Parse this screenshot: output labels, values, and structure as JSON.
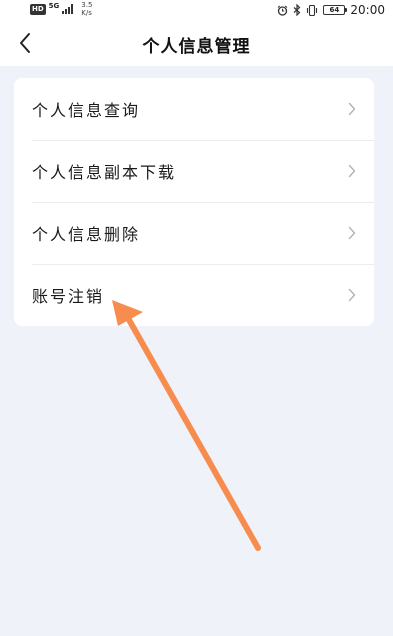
{
  "status_bar": {
    "hd": "HD",
    "network": "5G",
    "speed_value": "3.5",
    "speed_unit": "K/s",
    "battery": "64",
    "time": "20:00"
  },
  "header": {
    "title": "个人信息管理"
  },
  "menu": {
    "items": [
      {
        "label": "个人信息查询"
      },
      {
        "label": "个人信息副本下载"
      },
      {
        "label": "个人信息删除"
      },
      {
        "label": "账号注销"
      }
    ]
  },
  "colors": {
    "background": "#eff2f9",
    "card": "#ffffff",
    "chevron": "#b5b5b5",
    "annotation_arrow": "#f68d4e"
  },
  "icons": {
    "back": "chevron-left-icon",
    "menu_item": "chevron-right-icon",
    "annotation": "arrow-annotation"
  }
}
